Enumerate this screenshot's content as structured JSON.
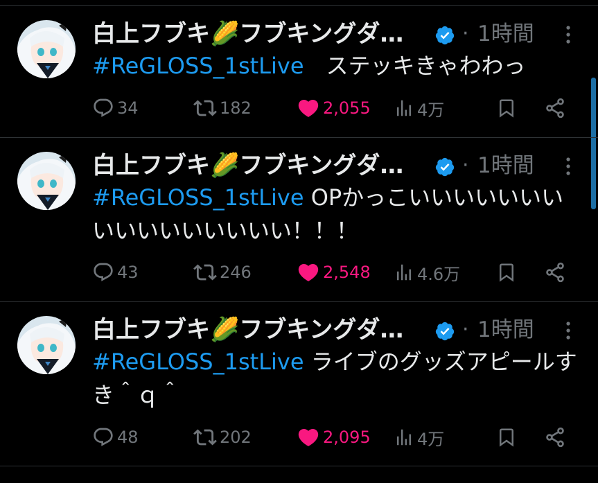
{
  "colors": {
    "background": "#000000",
    "text": "#e7e9ea",
    "muted": "#71767b",
    "hashtag": "#1d9bf0",
    "like": "#f91880",
    "verified": "#1d9bf0",
    "divider": "#2f3336"
  },
  "tweets": [
    {
      "author": {
        "name": "白上フブキ🌽フブキングダ…",
        "verified_icon": "verified-badge-icon"
      },
      "separator": "·",
      "time": "1時間",
      "hashtag": "#ReGLOSS_1stLive",
      "text": "　ステッキきゃわわっ",
      "stats": {
        "replies": "34",
        "retweets": "182",
        "likes": "2,055",
        "views": "4万"
      }
    },
    {
      "author": {
        "name": "白上フブキ🌽フブキングダ…",
        "verified_icon": "verified-badge-icon"
      },
      "separator": "·",
      "time": "1時間",
      "hashtag": "#ReGLOSS_1stLive",
      "text": " OPかっこいいいいいいいいいいいいいいいい！！！",
      "stats": {
        "replies": "43",
        "retweets": "246",
        "likes": "2,548",
        "views": "4.6万"
      }
    },
    {
      "author": {
        "name": "白上フブキ🌽フブキングダ…",
        "verified_icon": "verified-badge-icon"
      },
      "separator": "·",
      "time": "1時間",
      "hashtag": "#ReGLOSS_1stLive",
      "text": " ライブのグッズアピールすき＾ｑ＾",
      "stats": {
        "replies": "48",
        "retweets": "202",
        "likes": "2,095",
        "views": "4万"
      }
    }
  ]
}
